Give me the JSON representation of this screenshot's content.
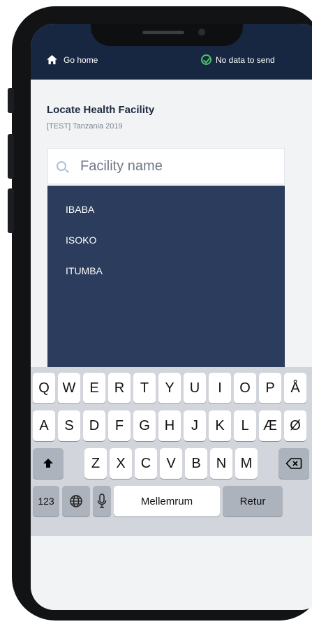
{
  "header": {
    "home_label": "Go home",
    "status_label": "No data to send"
  },
  "page": {
    "title": "Locate Health Facility",
    "subtitle": "[TEST] Tanzania 2019"
  },
  "search": {
    "placeholder": "Facility name",
    "value": ""
  },
  "results": [
    "IBABA",
    "ISOKO",
    "ITUMBA"
  ],
  "keyboard": {
    "row1": [
      "Q",
      "W",
      "E",
      "R",
      "T",
      "Y",
      "U",
      "I",
      "O",
      "P",
      "Å"
    ],
    "row2": [
      "A",
      "S",
      "D",
      "F",
      "G",
      "H",
      "J",
      "K",
      "L",
      "Æ",
      "Ø"
    ],
    "row3": [
      "Z",
      "X",
      "C",
      "V",
      "B",
      "N",
      "M"
    ],
    "numbers_label": "123",
    "space_label": "Mellemrum",
    "return_label": "Retur"
  },
  "colors": {
    "header": "#182741",
    "results_bg": "#2b3c5c",
    "success": "#4cc26a"
  },
  "icons": [
    "home-icon",
    "check-circle-icon",
    "search-icon",
    "shift-icon",
    "backspace-icon",
    "globe-icon",
    "microphone-icon"
  ]
}
